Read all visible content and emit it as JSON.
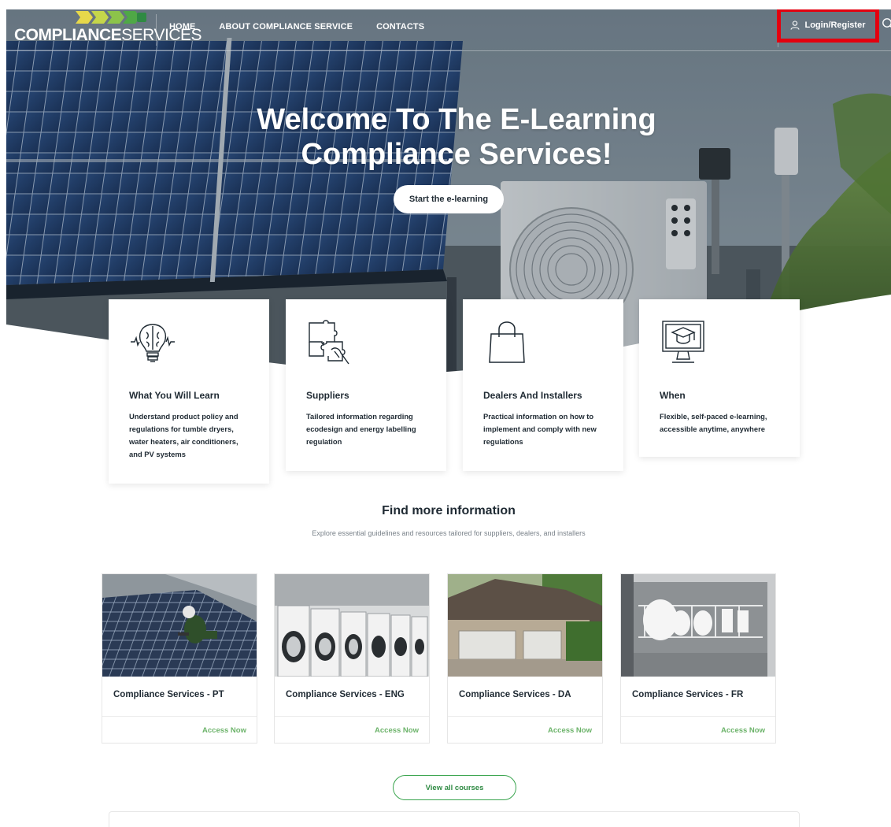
{
  "nav": {
    "logo": {
      "bold": "COMPLIANCE",
      "light": "SERVICES"
    },
    "links": [
      "HOME",
      "ABOUT COMPLIANCE SERVICE",
      "CONTACTS"
    ],
    "login_label": "Login/Register"
  },
  "hero": {
    "title_line1": "Welcome To The E-Learning",
    "title_line2": "Compliance Services!",
    "cta": "Start the e-learning"
  },
  "features": [
    {
      "icon": "brain-lightbulb-icon",
      "title": "What You Will Learn",
      "desc": "Understand product policy and regulations for tumble dryers, water heaters, air conditioners, and PV systems"
    },
    {
      "icon": "puzzle-icon",
      "title": "Suppliers",
      "desc": "Tailored information regarding ecodesign and energy labelling regulation"
    },
    {
      "icon": "shopping-bag-icon",
      "title": "Dealers And Installers",
      "desc": "Practical information on how to implement and comply with new regulations"
    },
    {
      "icon": "monitor-graduation-icon",
      "title": "When",
      "desc": "Flexible, self-paced e-learning, accessible anytime, anywhere"
    }
  ],
  "more_info": {
    "title": "Find more information",
    "subtitle": "Explore essential guidelines and resources tailored for suppliers, dealers, and installers"
  },
  "courses": [
    {
      "title": "Compliance Services - PT",
      "access": "Access Now"
    },
    {
      "title": "Compliance Services - ENG",
      "access": "Access Now"
    },
    {
      "title": "Compliance Services - DA",
      "access": "Access Now"
    },
    {
      "title": "Compliance Services - FR",
      "access": "Access Now"
    }
  ],
  "view_all": "View all courses",
  "colors": {
    "accent_green": "#39a44d",
    "access_green": "#6cb36a",
    "highlight_red": "#e3000f"
  }
}
